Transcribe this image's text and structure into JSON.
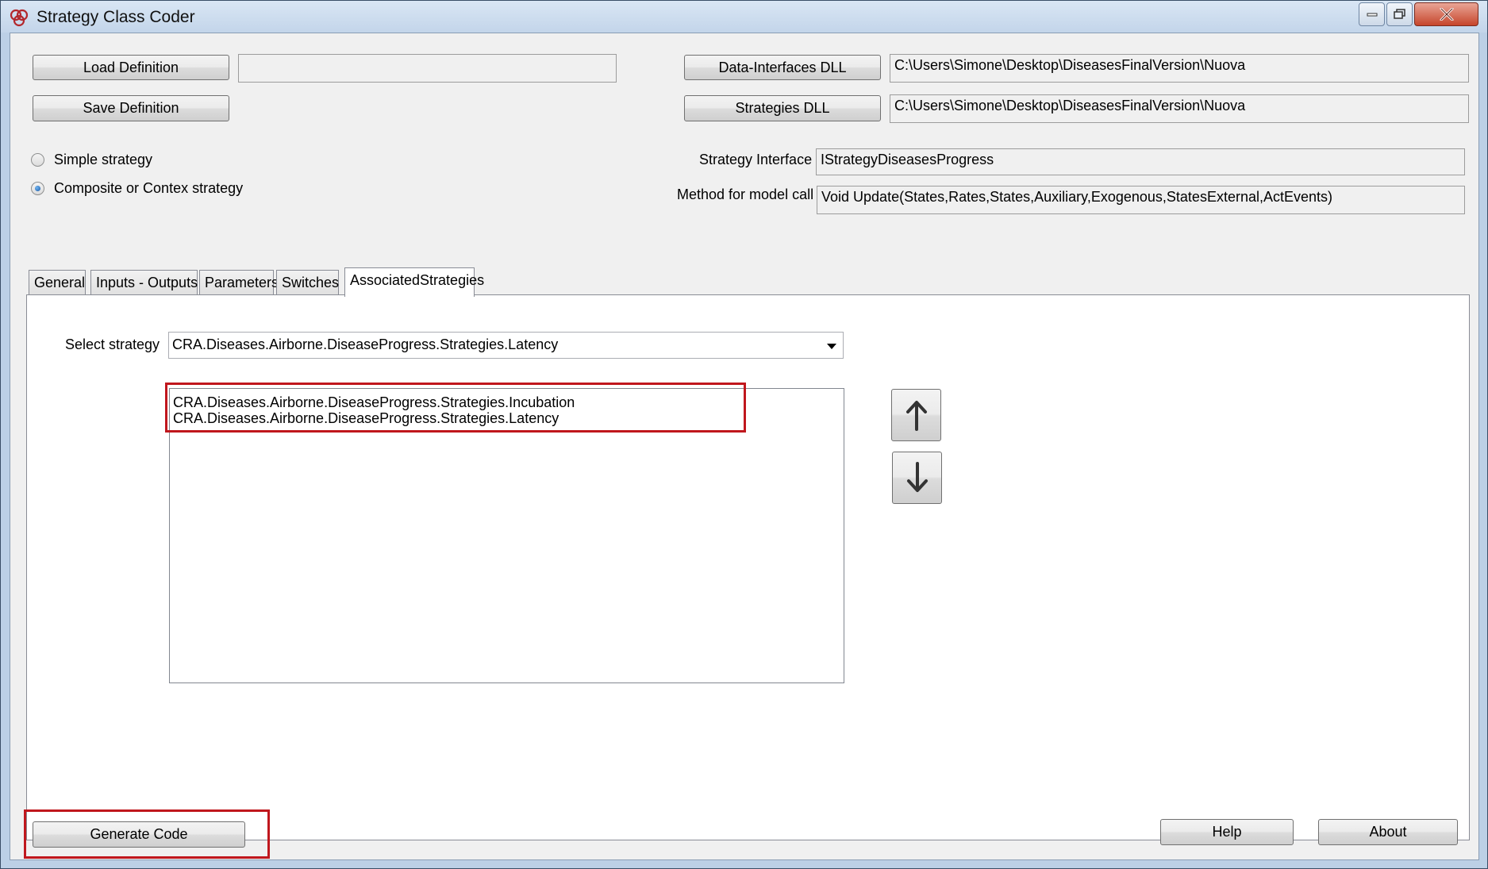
{
  "window": {
    "title": "Strategy Class Coder"
  },
  "top": {
    "load_definition": "Load Definition",
    "load_definition_path": "",
    "save_definition": "Save Definition",
    "data_interfaces_dll": "Data-Interfaces DLL",
    "data_interfaces_path": "C:\\Users\\Simone\\Desktop\\DiseasesFinalVersion\\Nuova",
    "strategies_dll": "Strategies DLL",
    "strategies_path": "C:\\Users\\Simone\\Desktop\\DiseasesFinalVersion\\Nuova"
  },
  "strategy_type": {
    "options": [
      "Simple strategy",
      "Composite or Contex strategy"
    ],
    "selected": "Composite or Contex strategy"
  },
  "interface": {
    "strategy_interface_label": "Strategy Interface",
    "strategy_interface_value": "IStrategyDiseasesProgress",
    "method_label": "Method for model call",
    "method_value": "Void Update(States,Rates,States,Auxiliary,Exogenous,StatesExternal,ActEvents)"
  },
  "tabs": [
    "General",
    "Inputs - Outputs",
    "Parameters",
    "Switches",
    "AssociatedStrategies"
  ],
  "active_tab": "AssociatedStrategies",
  "associated": {
    "select_label": "Select strategy",
    "selected_strategy": "CRA.Diseases.Airborne.DiseaseProgress.Strategies.Latency",
    "list_items": [
      "CRA.Diseases.Airborne.DiseaseProgress.Strategies.Incubation",
      "CRA.Diseases.Airborne.DiseaseProgress.Strategies.Latency"
    ]
  },
  "bottom": {
    "generate_code": "Generate Code",
    "help": "Help",
    "about": "About"
  },
  "colors": {
    "highlight": "#c0171d",
    "radio_selected": "#1c5aa5"
  },
  "icons": [
    "app-logo-icon",
    "minimize-icon",
    "maximize-icon",
    "close-icon",
    "arrow-up-icon",
    "arrow-down-icon",
    "dropdown-arrow-icon"
  ]
}
